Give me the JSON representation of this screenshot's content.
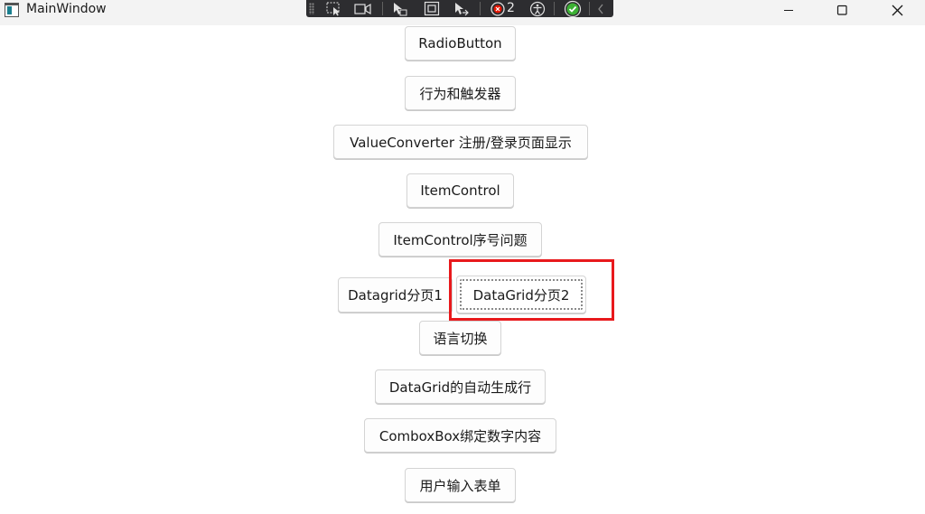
{
  "window": {
    "title": "MainWindow"
  },
  "debug_toolbar": {
    "error_count": "2",
    "icons": [
      "select-element-icon",
      "display-layout-icon",
      "track-focus-icon",
      "adorner-icon",
      "preview-selection-icon",
      "binding-failures-icon",
      "accessibility-icon",
      "hot-reload-ok-icon",
      "collapse-icon"
    ]
  },
  "buttons": {
    "radio_button": "RadioButton",
    "behavior_trigger": "行为和触发器",
    "value_converter": "ValueConverter 注册/登录页面显示",
    "item_control": "ItemControl",
    "item_control_index": "ItemControl序号问题",
    "datagrid_page1": "Datagrid分页1",
    "datagrid_page2": "DataGrid分页2",
    "language_switch": "语言切换",
    "datagrid_autogen": "DataGrid的自动生成行",
    "combobox_binding": "ComboxBox绑定数字内容",
    "user_input_form": "用户输入表单"
  },
  "colors": {
    "highlight": "#e8191c",
    "title_bar": "#f3f3f3",
    "debug_toolbar": "#2d2d30"
  }
}
